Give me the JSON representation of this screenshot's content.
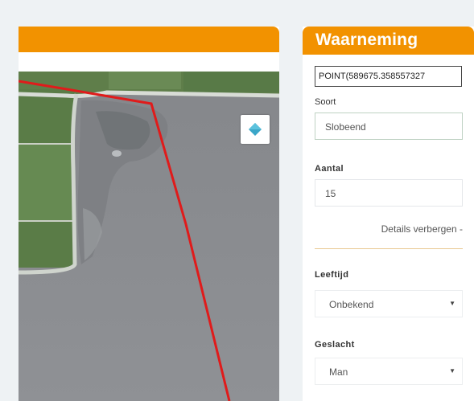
{
  "map": {
    "layer_icon": "layers-icon"
  },
  "panel": {
    "title": "Waarneming",
    "coordinate_value": "POINT(589675.358557327",
    "species": {
      "label": "Soort",
      "value": "Slobeend"
    },
    "count": {
      "label": "Aantal",
      "value": "15"
    },
    "details_link": "Details verbergen -",
    "age": {
      "label": "Leeftijd",
      "value": "Onbekend",
      "icon": "chevron-down-icon"
    },
    "sex": {
      "label": "Geslacht",
      "value": "Man",
      "icon": "chevron-down-icon"
    }
  },
  "colors": {
    "header": "#f29200",
    "boundary": "#e01b1b",
    "water": "#8c8e92",
    "field": "#62864e"
  }
}
